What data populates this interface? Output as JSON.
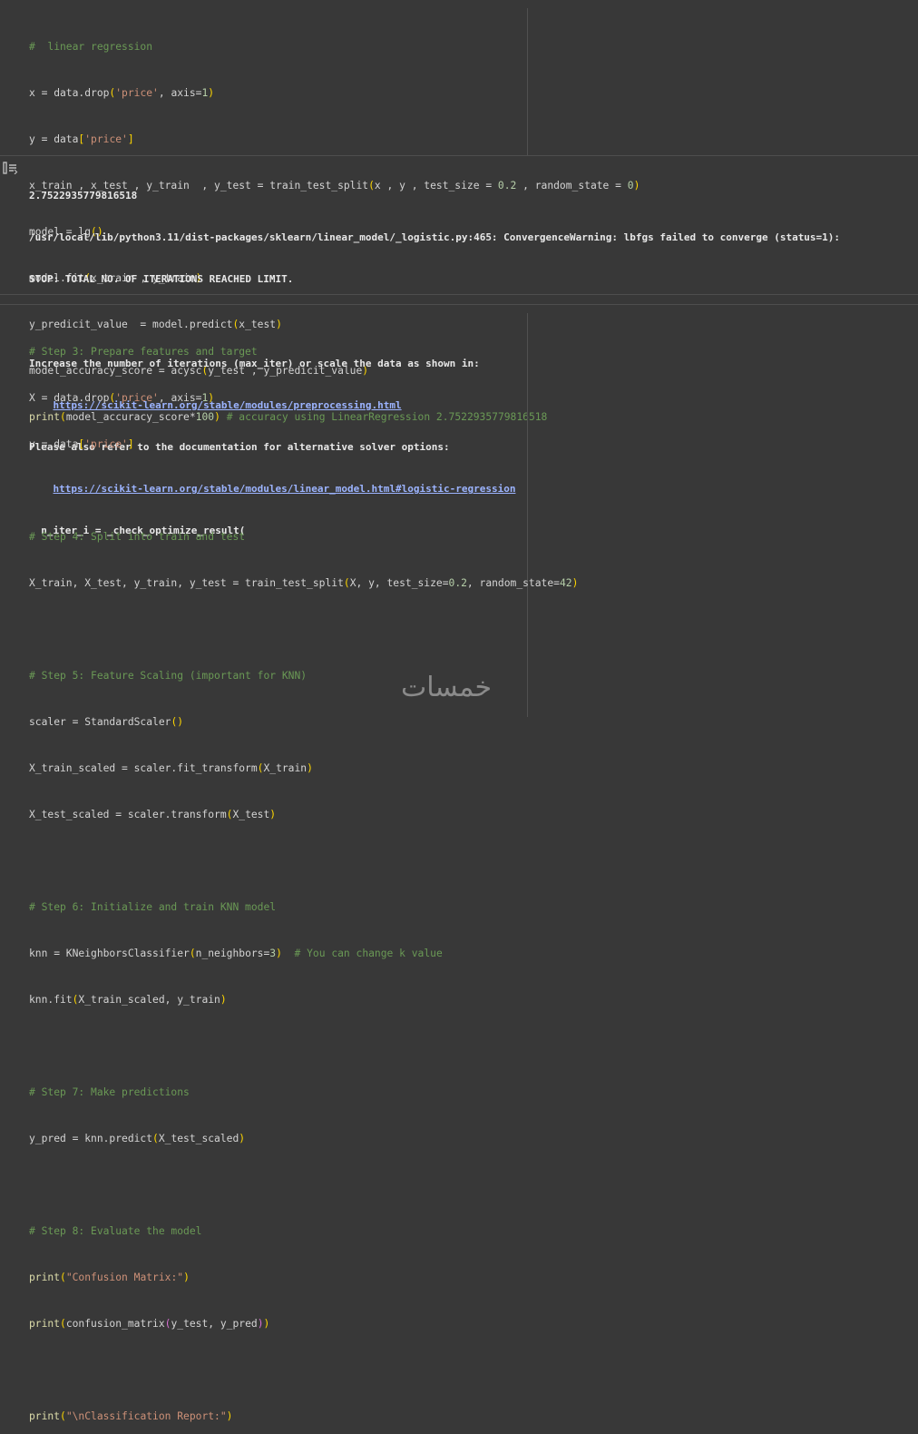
{
  "cell1": {
    "lines": [
      "#  linear regression",
      "x = data.drop('price', axis=1)",
      "y = data['price']",
      "x_train , x_test , y_train  , y_test = train_test_split(x , y , test_size = 0.2 , random_state = 0)",
      "model = lg()",
      "model.fit(x_train , y_train)",
      "y_predicit_value  = model.predict(x_test)",
      "model_accuracy_score = acysc(y_test , y_predicit_value)",
      "print(model_accuracy_score*100) # accuracy using LinearRegression 2.7522935779816518"
    ]
  },
  "output1": {
    "lines": [
      "2.7522935779816518",
      "/usr/local/lib/python3.11/dist-packages/sklearn/linear_model/_logistic.py:465: ConvergenceWarning: lbfgs failed to converge (status=1):",
      "STOP: TOTAL NO. OF ITERATIONS REACHED LIMIT.",
      "",
      "Increase the number of iterations (max_iter) or scale the data as shown in:",
      "    https://scikit-learn.org/stable/modules/preprocessing.html",
      "Please also refer to the documentation for alternative solver options:",
      "    https://scikit-learn.org/stable/modules/linear_model.html#logistic-regression",
      "  n_iter_i = _check_optimize_result("
    ],
    "link1": "https://scikit-learn.org/stable/modules/preprocessing.html",
    "link2": "https://scikit-learn.org/stable/modules/linear_model.html#logistic-regression"
  },
  "cell2": {
    "lines": [
      "# Step 3: Prepare features and target",
      "X = data.drop('price', axis=1)",
      "y = data['price']",
      "",
      "# Step 4: Split into train and test",
      "X_train, X_test, y_train, y_test = train_test_split(X, y, test_size=0.2, random_state=42)",
      "",
      "# Step 5: Feature Scaling (important for KNN)",
      "scaler = StandardScaler()",
      "X_train_scaled = scaler.fit_transform(X_train)",
      "X_test_scaled = scaler.transform(X_test)",
      "",
      "# Step 6: Initialize and train KNN model",
      "knn = KNeighborsClassifier(n_neighbors=3)  # You can change k value",
      "knn.fit(X_train_scaled, y_train)",
      "",
      "# Step 7: Make predictions",
      "y_pred = knn.predict(X_test_scaled)",
      "",
      "# Step 8: Evaluate the model",
      "print(\"Confusion Matrix:\")",
      "print(confusion_matrix(y_test, y_pred))",
      "",
      "print(\"\\nClassification Report:\")",
      "print(classification_report(y_test, y_pred))"
    ]
  },
  "watermark": "خمسات",
  "colors": {
    "background": "#383838",
    "comment": "#6a9955",
    "string": "#ce9178",
    "number": "#b5cea8",
    "bracket": "#ffd700",
    "link": "#9cb4ff"
  }
}
